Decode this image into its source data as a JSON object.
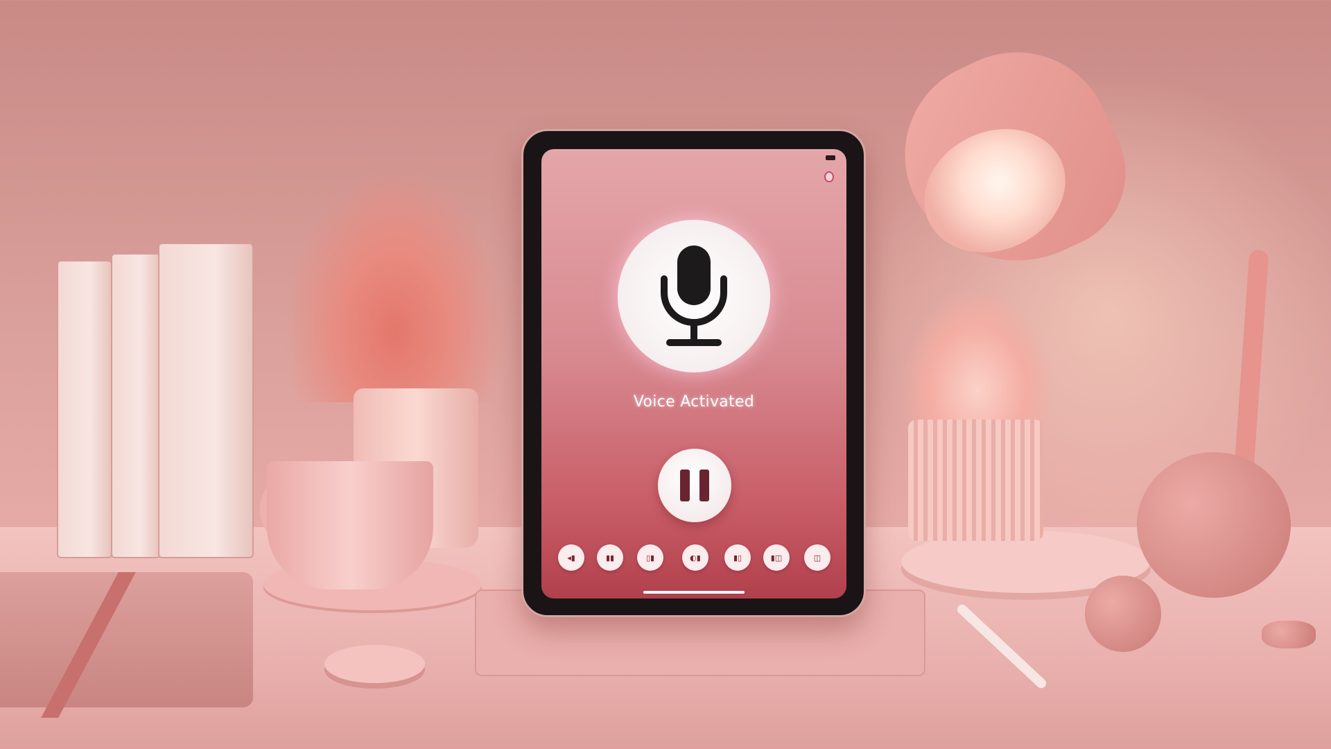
{
  "scene": {
    "colors": {
      "wall": "#d39792",
      "desk": "#efbdba",
      "accent": "#c85c66"
    }
  },
  "tablet": {
    "status_bar": {
      "battery_icon": "battery-icon"
    },
    "record_indicator_icon": "record-dot-icon",
    "mic_icon": "microphone-icon",
    "label": "Voice Activated",
    "pause_icon": "pause-icon",
    "controls": [
      {
        "icon": "control-1-icon"
      },
      {
        "icon": "control-2-icon"
      },
      {
        "icon": "control-3-icon"
      },
      {
        "icon": "control-4-icon"
      },
      {
        "icon": "control-5-icon"
      },
      {
        "icon": "control-6-icon"
      },
      {
        "icon": "control-7-icon"
      }
    ]
  }
}
